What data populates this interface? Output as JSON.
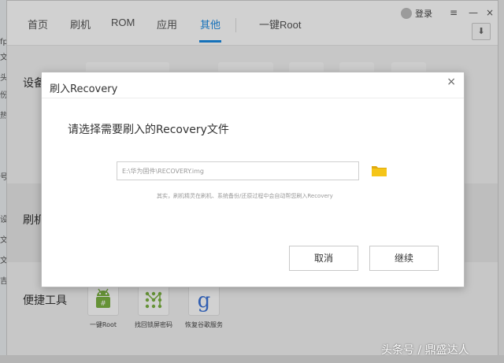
{
  "nav": {
    "tabs": [
      {
        "label": "首页"
      },
      {
        "label": "刷机"
      },
      {
        "label": "ROM"
      },
      {
        "label": "应用"
      },
      {
        "label": "其他"
      },
      {
        "label": "一键Root"
      }
    ],
    "active_tab": "其他",
    "login_label": "登录",
    "menu_glyph": "≡",
    "minimize_glyph": "—",
    "close_glyph": "×",
    "download_glyph": "⬇"
  },
  "background": {
    "sections": {
      "settings": "设备",
      "flash": "刷机",
      "tools": "便捷工具"
    },
    "tools": [
      {
        "label": "一键Root",
        "icon": "android-icon"
      },
      {
        "label": "找回锁屏密码",
        "icon": "pattern-lock-icon"
      },
      {
        "label": "恢复谷歌服务",
        "icon": "google-icon"
      }
    ],
    "side_fragments": [
      "fp",
      "文",
      "头",
      "份",
      "热",
      "号",
      "设",
      "文",
      "文",
      "吉"
    ]
  },
  "dialog": {
    "title": "刷入Recovery",
    "close_glyph": "×",
    "heading": "请选择需要刷入的Recovery文件",
    "path_value": "E:\\华为固件\\RECOVERY.img",
    "hint": "其实，刷机精灵在刷机、系统备份/还原过程中会自动帮您刷入Recovery",
    "cancel_label": "取消",
    "continue_label": "继续"
  },
  "watermark": "头条号 / 鼎盛达人",
  "colors": {
    "accent": "#1a8ae3",
    "folder": "#f5c518"
  }
}
